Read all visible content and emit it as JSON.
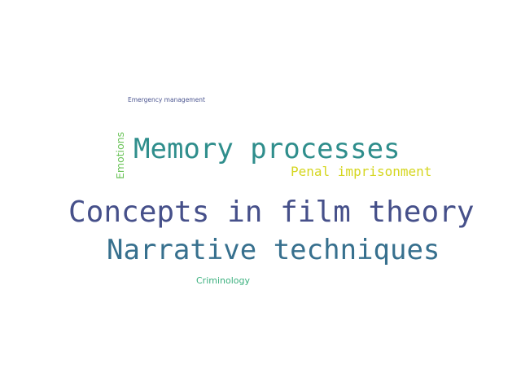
{
  "words": [
    {
      "text": "Concepts in film theory",
      "color": "#46508a"
    },
    {
      "text": "Memory processes",
      "color": "#2f8e8c"
    },
    {
      "text": "Narrative techniques",
      "color": "#37708e"
    },
    {
      "text": "Penal imprisonment",
      "color": "#d5d620"
    },
    {
      "text": "Criminology",
      "color": "#3bb07e"
    },
    {
      "text": "Emergency management",
      "color": "#4b5590"
    },
    {
      "text": "Emotions",
      "color": "#6cc45a"
    }
  ]
}
